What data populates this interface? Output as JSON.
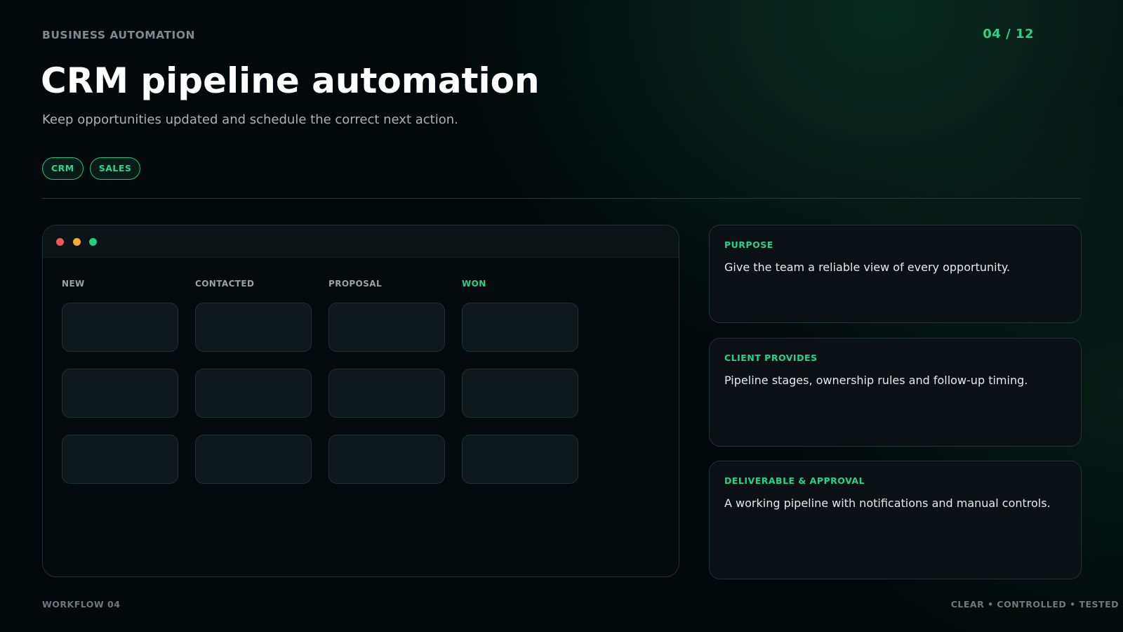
{
  "header": {
    "kicker": "BUSINESS AUTOMATION",
    "page_counter": "04 / 12",
    "title": "CRM pipeline automation",
    "subtitle": "Keep opportunities updated and schedule the correct next action."
  },
  "tags": [
    "CRM",
    "SALES"
  ],
  "board": {
    "columns": [
      "NEW",
      "CONTACTED",
      "PROPOSAL",
      "WON"
    ],
    "rows_per_column": 3
  },
  "panels": [
    {
      "label": "PURPOSE",
      "text": "Give the team a reliable view of every opportunity."
    },
    {
      "label": "CLIENT PROVIDES",
      "text": "Pipeline stages, ownership rules and follow-up timing."
    },
    {
      "label": "DELIVERABLE & APPROVAL",
      "text": "A working pipeline with notifications and manual controls."
    }
  ],
  "footer": {
    "left": "WORKFLOW 04",
    "right": "CLEAR • CONTROLLED • TESTED"
  },
  "colors": {
    "accent": "#22d58b",
    "background": "#03080a",
    "window_dot_red": "#f0565c",
    "window_dot_yellow": "#f5ad33",
    "window_dot_green": "#22cf7d"
  }
}
